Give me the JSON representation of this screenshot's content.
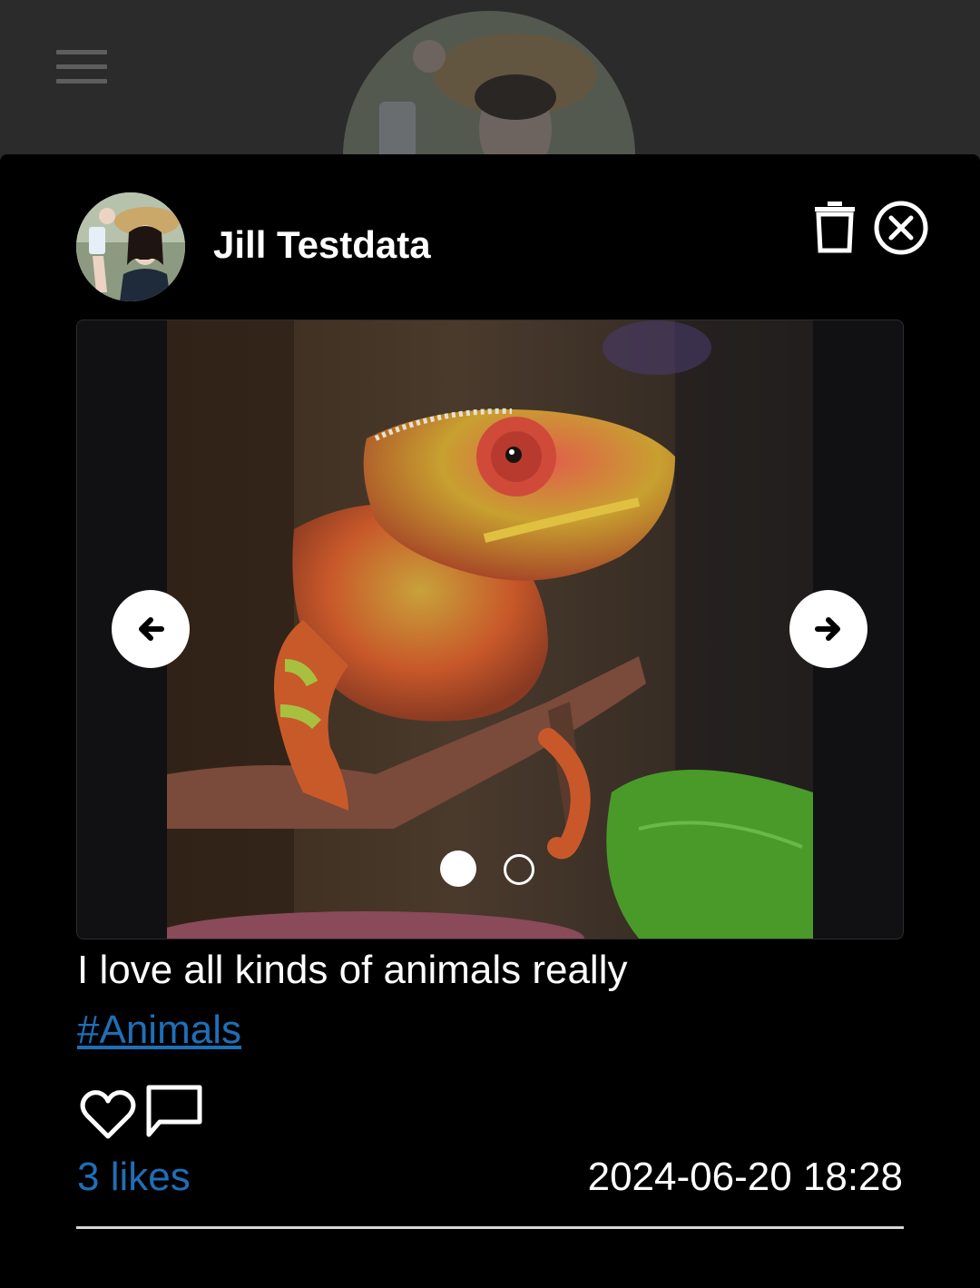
{
  "post": {
    "author_name": "Jill Testdata",
    "caption": "I love all kinds of animals really",
    "hashtag": "#Animals",
    "likes_text": "3 likes",
    "timestamp": "2024-06-20 18:28"
  },
  "carousel": {
    "slide_count": 2,
    "active_slide": 1
  },
  "icons": {
    "menu": "hamburger-menu-icon",
    "delete": "trash-icon",
    "close": "close-circle-icon",
    "prev": "arrow-left-icon",
    "next": "arrow-right-icon",
    "like": "heart-outline-icon",
    "comment": "comment-bubble-icon"
  },
  "colors": {
    "background": "#000000",
    "link": "#1f6fb8",
    "text": "#ffffff",
    "dimmed_header": "#2b2b2b"
  }
}
